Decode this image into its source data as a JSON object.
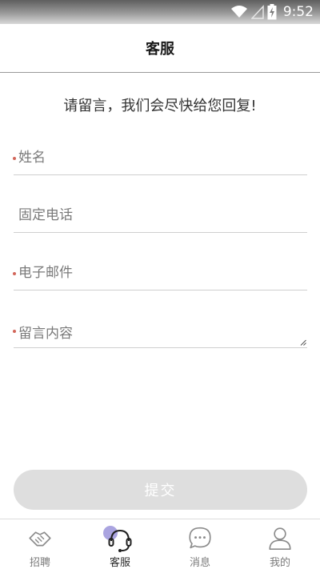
{
  "status_bar": {
    "time": "9:52"
  },
  "header": {
    "title": "客服"
  },
  "intro": {
    "text": "请留言，我们会尽快给您回复!"
  },
  "form": {
    "name_placeholder": "姓名",
    "phone_placeholder": "固定电话",
    "email_placeholder": "电子邮件",
    "message_placeholder": "留言内容"
  },
  "submit": {
    "label": "提交"
  },
  "tabs": [
    {
      "label": "招聘",
      "icon": "handshake-icon"
    },
    {
      "label": "客服",
      "icon": "headset-icon"
    },
    {
      "label": "消息",
      "icon": "chat-bubble-icon"
    },
    {
      "label": "我的",
      "icon": "user-icon"
    }
  ],
  "colors": {
    "required_marker": "#d2665a",
    "active_indicator": "#aaa4e0",
    "submit_disabled": "#dedede"
  }
}
